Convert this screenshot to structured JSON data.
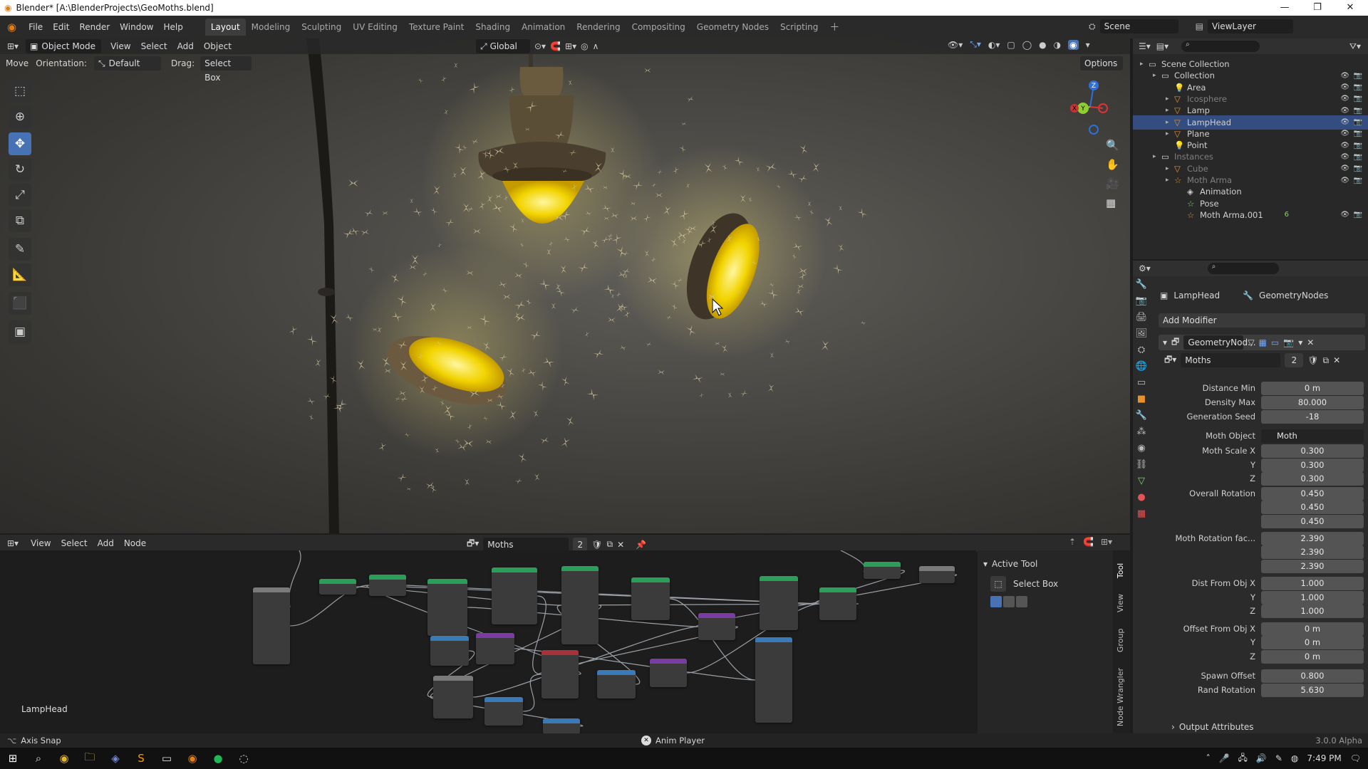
{
  "window": {
    "title": "Blender* [A:\\BlenderProjects\\GeoMoths.blend]",
    "controls": [
      "—",
      "❐",
      "✕"
    ]
  },
  "menu": [
    "File",
    "Edit",
    "Render",
    "Window",
    "Help"
  ],
  "workspaces": [
    "Layout",
    "Modeling",
    "Sculpting",
    "UV Editing",
    "Texture Paint",
    "Shading",
    "Animation",
    "Rendering",
    "Compositing",
    "Geometry Nodes",
    "Scripting"
  ],
  "active_workspace": "Layout",
  "scene": "Scene",
  "view_layer": "ViewLayer",
  "viewport": {
    "mode": "Object Mode",
    "menus": [
      "View",
      "Select",
      "Add",
      "Object"
    ],
    "transform_space": "Global",
    "tool_settings": {
      "tool": "Move",
      "orientation_label": "Orientation:",
      "orientation_value": "Default",
      "drag_label": "Drag:",
      "drag_value": "Select Box",
      "options": "Options"
    },
    "gizmo_axes": [
      "Z",
      "Y",
      "X"
    ]
  },
  "outliner": {
    "rows": [
      {
        "label": "Scene Collection",
        "indent": 0,
        "kind": "scene",
        "dim": false
      },
      {
        "label": "Collection",
        "indent": 1,
        "kind": "collection",
        "dim": false
      },
      {
        "label": "Area",
        "indent": 2,
        "kind": "light",
        "dim": false
      },
      {
        "label": "Icosphere",
        "indent": 2,
        "kind": "mesh",
        "dim": true
      },
      {
        "label": "Lamp",
        "indent": 2,
        "kind": "mesh",
        "dim": false
      },
      {
        "label": "LampHead",
        "indent": 2,
        "kind": "mesh",
        "dim": false,
        "selected": true
      },
      {
        "label": "Plane",
        "indent": 2,
        "kind": "mesh",
        "dim": false
      },
      {
        "label": "Point",
        "indent": 2,
        "kind": "light",
        "dim": false
      },
      {
        "label": "Instances",
        "indent": 1,
        "kind": "collection",
        "dim": true
      },
      {
        "label": "Cube",
        "indent": 2,
        "kind": "mesh",
        "dim": true
      },
      {
        "label": "Moth Arma",
        "indent": 2,
        "kind": "armature",
        "dim": true
      },
      {
        "label": "Animation",
        "indent": 3,
        "kind": "anim",
        "dim": false
      },
      {
        "label": "Pose",
        "indent": 3,
        "kind": "pose",
        "dim": false
      },
      {
        "label": "Moth Arma.001",
        "indent": 3,
        "kind": "armature",
        "dim": false
      }
    ],
    "extra_badge": "6"
  },
  "properties": {
    "breadcrumb_object": "LampHead",
    "breadcrumb_modifier": "GeometryNodes",
    "add_modifier": "Add Modifier",
    "modifier_name": "GeometryNod...",
    "node_group": "Moths",
    "node_group_users": "2",
    "fields": [
      {
        "label": "Distance Min",
        "value": "0 m"
      },
      {
        "label": "Density Max",
        "value": "80.000"
      },
      {
        "label": "Generation Seed",
        "value": "-18"
      },
      {
        "label": "Moth Object",
        "value": "Moth",
        "type": "object"
      },
      {
        "label": "Moth Scale X",
        "value": "0.300"
      },
      {
        "label": "Y",
        "value": "0.300"
      },
      {
        "label": "Z",
        "value": "0.300"
      },
      {
        "label": "Overall Rotation",
        "value": "0.450"
      },
      {
        "label": "",
        "value": "0.450"
      },
      {
        "label": "",
        "value": "0.450"
      },
      {
        "label": "Moth Rotation fac...",
        "value": "2.390"
      },
      {
        "label": "",
        "value": "2.390"
      },
      {
        "label": "",
        "value": "2.390"
      },
      {
        "label": "Dist From Obj X",
        "value": "1.000"
      },
      {
        "label": "Y",
        "value": "1.000"
      },
      {
        "label": "Z",
        "value": "1.000"
      },
      {
        "label": "Offset From Obj X",
        "value": "0 m"
      },
      {
        "label": "Y",
        "value": "0 m"
      },
      {
        "label": "Z",
        "value": "0 m"
      },
      {
        "label": "Spawn Offset",
        "value": "0.800"
      },
      {
        "label": "Rand Rotation",
        "value": "5.630"
      }
    ],
    "output_attributes": "Output Attributes"
  },
  "node_editor": {
    "menus": [
      "View",
      "Select",
      "Add",
      "Node"
    ],
    "node_tree": "Moths",
    "users": "2",
    "object_label": "LampHead",
    "active_tool_title": "Active Tool",
    "active_tool_name": "Select Box",
    "side_tabs": [
      "Tool",
      "View",
      "Group",
      "Node Wrangler"
    ]
  },
  "status": {
    "left": "Axis Snap",
    "center": "Anim Player",
    "version": "3.0.0 Alpha"
  },
  "taskbar": {
    "time": "7:49 PM"
  }
}
